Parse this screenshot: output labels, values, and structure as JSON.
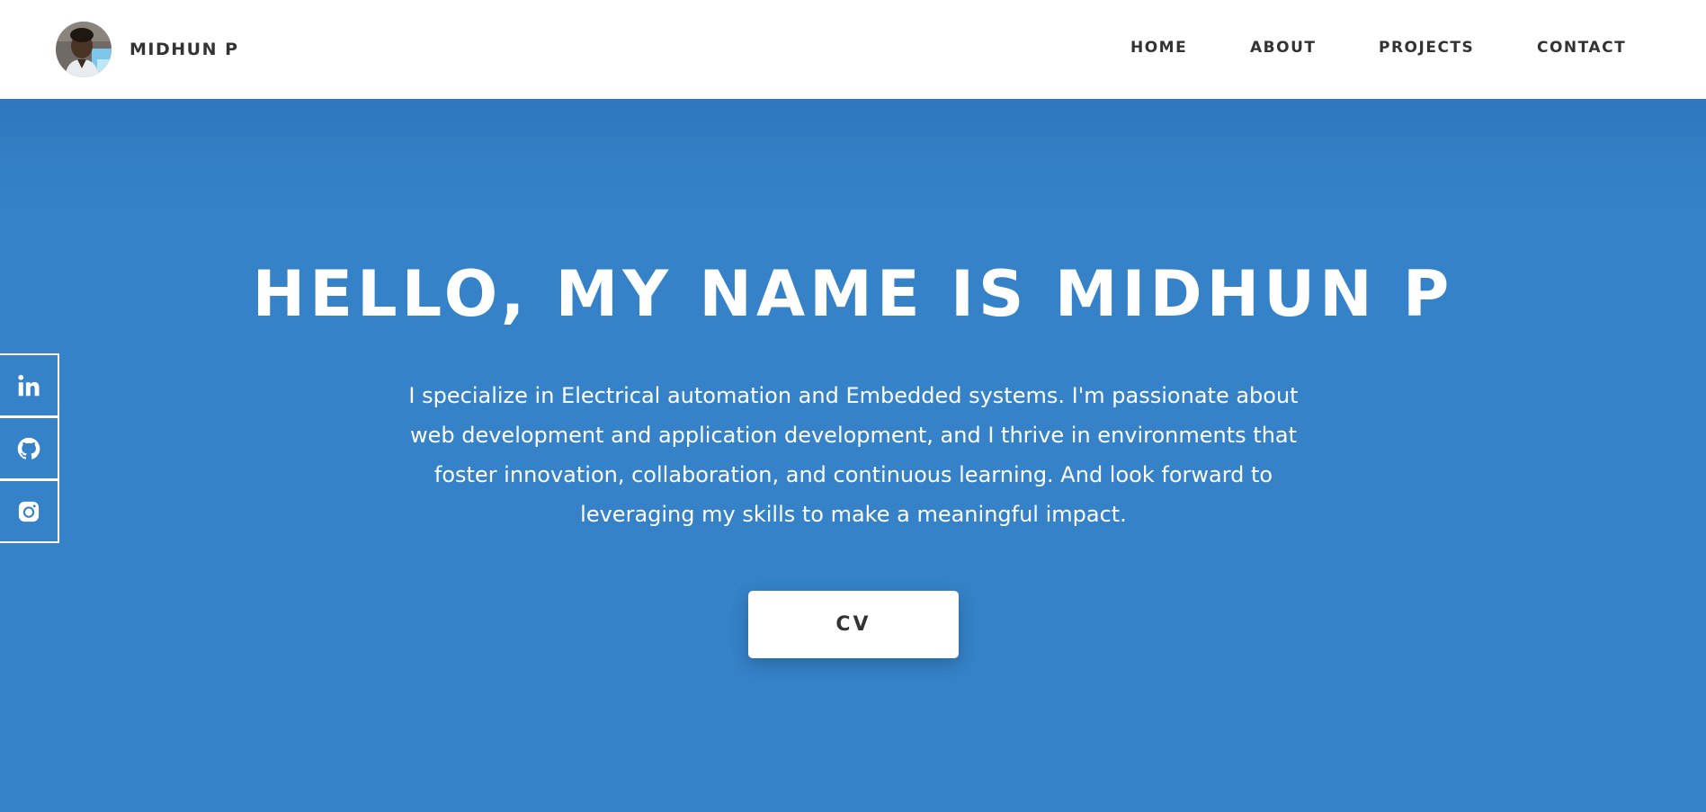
{
  "header": {
    "avatar_icon": "profile-photo-avatar",
    "brand_name": "MIDHUN P",
    "nav": [
      {
        "label": "HOME"
      },
      {
        "label": "ABOUT"
      },
      {
        "label": "PROJECTS"
      },
      {
        "label": "CONTACT"
      }
    ]
  },
  "hero": {
    "title": "HELLO, MY NAME IS MIDHUN P",
    "description": "I specialize in Electrical automation and Embedded systems. I'm passionate about web development and application development, and I thrive in environments that foster innovation, collaboration, and continuous learning. And look forward to leveraging my skills to make a meaningful impact.",
    "cv_label": "CV"
  },
  "social": [
    {
      "icon": "linkedin-icon"
    },
    {
      "icon": "github-icon"
    },
    {
      "icon": "instagram-icon"
    }
  ],
  "colors": {
    "hero_background": "#3582c8",
    "header_background": "#ffffff",
    "text_dark": "#333333",
    "text_light": "#ffffff"
  }
}
